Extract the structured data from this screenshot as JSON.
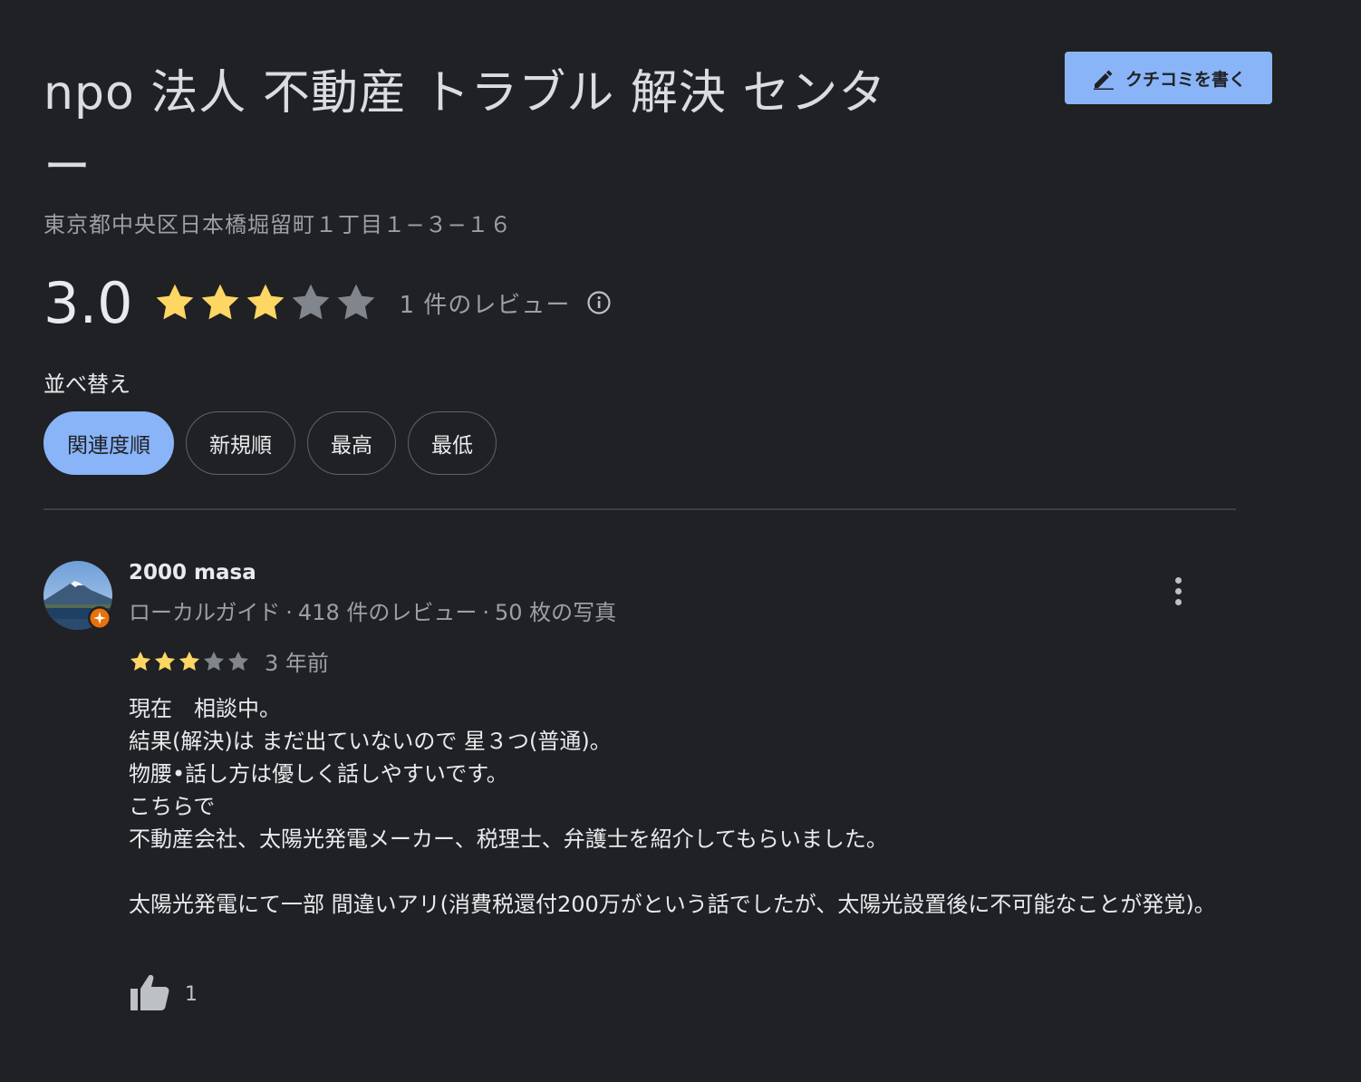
{
  "place": {
    "title": "npo 法人 不動産 トラブル 解決 センター",
    "address": "東京都中央区日本橋堀留町１丁目１−３−１６"
  },
  "write_review": {
    "label": "クチコミを書く",
    "icon": "pencil-icon"
  },
  "rating": {
    "value": "3.0",
    "stars": 3,
    "max_stars": 5,
    "count_label": "1 件のレビュー",
    "info_icon": "info-icon"
  },
  "sort": {
    "label": "並べ替え",
    "options": [
      "関連度順",
      "新規順",
      "最高",
      "最低"
    ],
    "selected": "関連度順"
  },
  "review": {
    "author": "2000 masa",
    "badge": "ローカルガイド",
    "review_count": "418 件のレビュー",
    "photo_count": "50 枚の写真",
    "stars": 3,
    "date": "3 年前",
    "body": [
      "現在　相談中。",
      "結果(解決)は まだ出ていないので 星３つ(普通)。",
      "物腰•話し方は優しく話しやすいです。",
      "こちらで",
      "不動産会社、太陽光発電メーカー、税理士、弁護士を紹介してもらいました。",
      "",
      "太陽光発電にて一部 間違いアリ(消費税還付200万がという話でしたが、太陽光設置後に不可能なことが発覚)。"
    ],
    "likes": "1"
  },
  "colors": {
    "background": "#202124",
    "accent": "#8ab4f8",
    "star_filled": "#fdd663",
    "star_empty": "#80868b",
    "text_secondary": "#9aa0a6"
  }
}
